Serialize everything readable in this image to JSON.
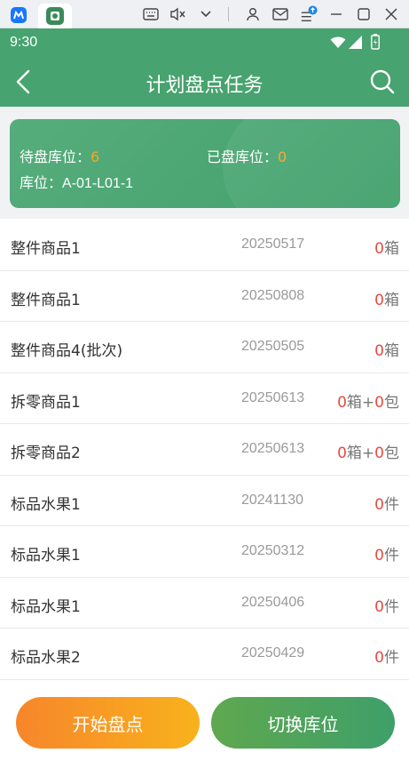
{
  "colors": {
    "header": "#47a36f",
    "accent_orange": "#f5a623",
    "red": "#e94a3f",
    "start_btn": "#f7862b",
    "switch_btn": "#3e9f6a"
  },
  "emulator_bar": {
    "icons": [
      "app-tab-icon",
      "app-tab-icon-active",
      "keyboard-icon",
      "mute-icon",
      "chevron-down-icon",
      "user-icon",
      "mail-icon",
      "menu-upload-icon",
      "minimize-icon",
      "maximize-icon",
      "close-icon"
    ]
  },
  "status_bar": {
    "time": "9:30"
  },
  "header": {
    "title": "计划盘点任务"
  },
  "summary": {
    "pending_label": "待盘库位：",
    "pending_count": "6",
    "done_label": "已盘库位：",
    "done_count": "0",
    "location_label": "库位：",
    "location_value": "A-01-L01-1"
  },
  "items": [
    {
      "name": "整件商品1",
      "date": "20250517",
      "qty": "0",
      "unit": "箱"
    },
    {
      "name": "整件商品1",
      "date": "20250808",
      "qty": "0",
      "unit": "箱"
    },
    {
      "name": "整件商品4(批次)",
      "date": "20250505",
      "qty": "0",
      "unit": "箱"
    },
    {
      "name": "拆零商品1",
      "date": "20250613",
      "qty": "0",
      "unit": "箱+",
      "qty2": "0",
      "unit2": "包"
    },
    {
      "name": "拆零商品2",
      "date": "20250613",
      "qty": "0",
      "unit": "箱+",
      "qty2": "0",
      "unit2": "包"
    },
    {
      "name": "标品水果1",
      "date": "20241130",
      "qty": "0",
      "unit": "件"
    },
    {
      "name": "标品水果1",
      "date": "20250312",
      "qty": "0",
      "unit": "件"
    },
    {
      "name": "标品水果1",
      "date": "20250406",
      "qty": "0",
      "unit": "件"
    },
    {
      "name": "标品水果2",
      "date": "20250429",
      "qty": "0",
      "unit": "件"
    }
  ],
  "footer": {
    "start_label": "开始盘点",
    "switch_label": "切换库位"
  }
}
